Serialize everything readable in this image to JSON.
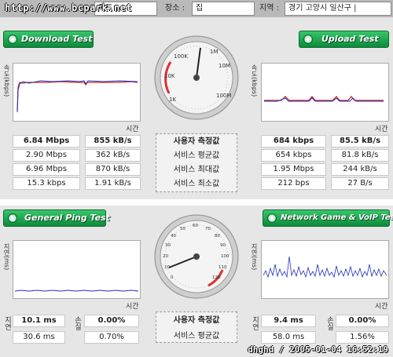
{
  "topbar": {
    "watermark": "http://www.bcpark.net",
    "isp_partial": "이트",
    "place_label": "장소 :",
    "place_value": "집",
    "region_label": "지역 :",
    "region_value": "경기 고양시 일산구 |"
  },
  "download": {
    "title": "Download Test",
    "y_label": "속도(kbps)",
    "x_label": "시간",
    "rows": [
      {
        "mbps": "6.84 Mbps",
        "kbs": "855 kB/s"
      },
      {
        "mbps": "2.90 Mbps",
        "kbs": "362 kB/s"
      },
      {
        "mbps": "6.96 Mbps",
        "kbs": "870 kB/s"
      },
      {
        "mbps": "15.3 kbps",
        "kbs": "1.91 kB/s"
      }
    ]
  },
  "upload": {
    "title": "Upload Test",
    "y_label": "속도(kbps)",
    "x_label": "시간",
    "rows": [
      {
        "mbps": "684 kbps",
        "kbs": "85.5 kB/s"
      },
      {
        "mbps": "654 kbps",
        "kbs": "81.8 kB/s"
      },
      {
        "mbps": "1.95 Mbps",
        "kbs": "244 kB/s"
      },
      {
        "mbps": "212 bps",
        "kbs": "27 B/s"
      }
    ]
  },
  "middle_labels": {
    "user": "사용자 측정값",
    "avg": "서비스 평균값",
    "max": "서비스 최대값",
    "min": "서비스 최소값"
  },
  "speed_gauge": {
    "labels": [
      "100K",
      "1M",
      "10M",
      "100M",
      "10K",
      "1K"
    ]
  },
  "ping": {
    "title": "General Ping Test",
    "y_label": "지연(ms)",
    "x_label": "시간",
    "left_labels": [
      "지연",
      "손실"
    ],
    "user": {
      "delay": "10.1 ms",
      "loss": "0.00%"
    },
    "avg": {
      "delay": "30.6 ms",
      "loss": "0.70%"
    }
  },
  "game": {
    "title": "Network Game & VoIP Test",
    "y_label": "지연(ms)",
    "x_label": "시간",
    "user": {
      "delay": "9.4 ms",
      "loss": "0.00%"
    },
    "avg": {
      "delay": "58.0 ms",
      "loss": "1.56%"
    }
  },
  "ping_gauge": {
    "labels": [
      "0",
      "10",
      "20",
      "30",
      "40",
      "50",
      "60",
      "70",
      "80",
      "90",
      "100",
      "110",
      "120"
    ]
  },
  "footer": {
    "stamp": "dhghd / 2005-01-04 16:52:19"
  },
  "colors": {
    "accent_green": "#0c8a3b",
    "line_red": "#d02020",
    "line_blue": "#2030c0"
  }
}
